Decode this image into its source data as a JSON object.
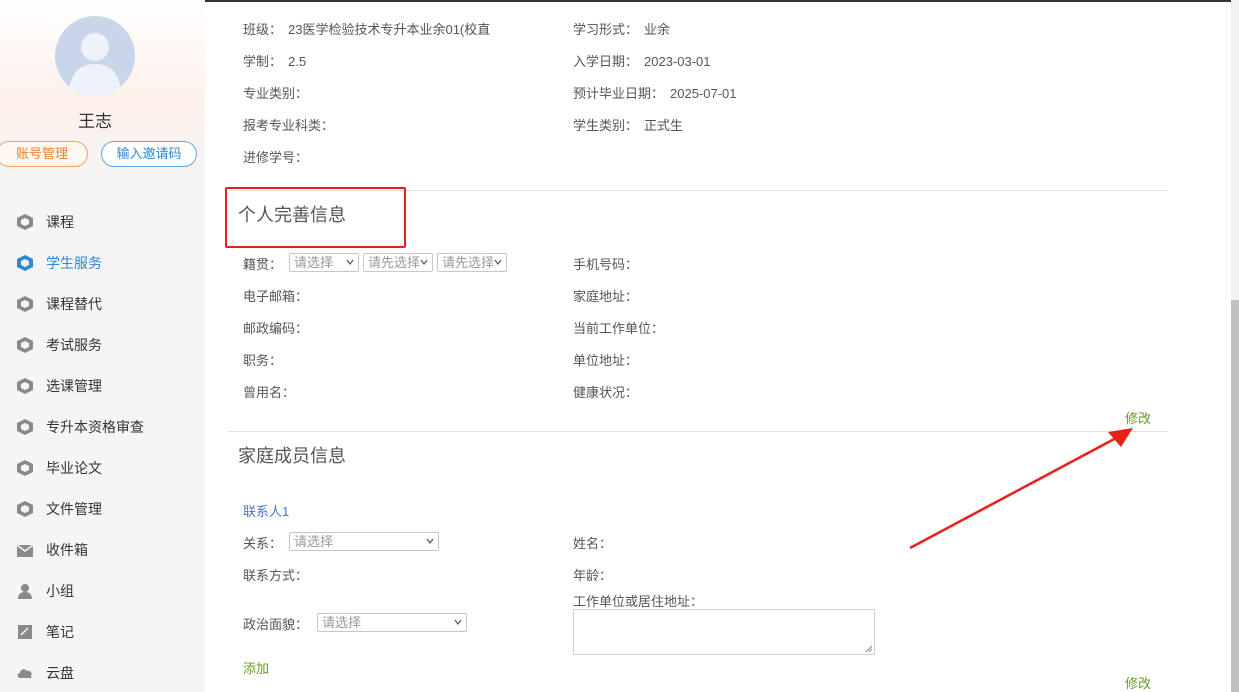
{
  "user": {
    "name": "王志"
  },
  "profile_buttons": {
    "account": "账号管理",
    "invite": "输入邀请码"
  },
  "nav": [
    {
      "label": "课程",
      "icon": "cube-icon"
    },
    {
      "label": "学生服务",
      "icon": "cube-icon",
      "active": true
    },
    {
      "label": "课程替代",
      "icon": "cube-icon"
    },
    {
      "label": "考试服务",
      "icon": "cube-icon"
    },
    {
      "label": "选课管理",
      "icon": "cube-icon"
    },
    {
      "label": "专升本资格审查",
      "icon": "cube-icon"
    },
    {
      "label": "毕业论文",
      "icon": "cube-icon"
    },
    {
      "label": "文件管理",
      "icon": "cube-icon"
    },
    {
      "label": "收件箱",
      "icon": "inbox-icon"
    },
    {
      "label": "小组",
      "icon": "user-icon"
    },
    {
      "label": "笔记",
      "icon": "note-icon"
    },
    {
      "label": "云盘",
      "icon": "cloud-icon"
    }
  ],
  "school": {
    "class_label": "班级：",
    "class_value": "23医学检验技术专升本业余01(校直",
    "mode_label": "学习形式：",
    "mode_value": "业余",
    "length_label": "学制：",
    "length_value": "2.5",
    "enroll_label": "入学日期：",
    "enroll_value": "2023-03-01",
    "major_type_label": "专业类别：",
    "grad_label": "预计毕业日期：",
    "grad_value": "2025-07-01",
    "exam_subject_label": "报考专业科类：",
    "student_type_label": "学生类别：",
    "student_type_value": "正式生",
    "advanced_id_label": "进修学号："
  },
  "personal": {
    "title": "个人完善信息",
    "native_label": "籍贯：",
    "native_selects": [
      "请选择",
      "请先选择",
      "请先选择"
    ],
    "phone_label": "手机号码：",
    "email_label": "电子邮箱：",
    "home_label": "家庭地址：",
    "zip_label": "邮政编码：",
    "work_label": "当前工作单位：",
    "job_label": "职务：",
    "work_addr_label": "单位地址：",
    "former_name_label": "曾用名：",
    "health_label": "健康状况：",
    "edit": "修改"
  },
  "family": {
    "title": "家庭成员信息",
    "contact_title": "联系人1",
    "relation_label": "关系：",
    "relation_select": "请选择",
    "name_label": "姓名：",
    "contact_label": "联系方式：",
    "age_label": "年龄：",
    "address_label": "工作单位或居住地址：",
    "political_label": "政治面貌：",
    "political_select": "请选择",
    "add": "添加",
    "edit": "修改"
  },
  "colors": {
    "active_nav": "#2f86d9",
    "link_green": "#6a9a2a",
    "highlight": "#e8201a"
  }
}
